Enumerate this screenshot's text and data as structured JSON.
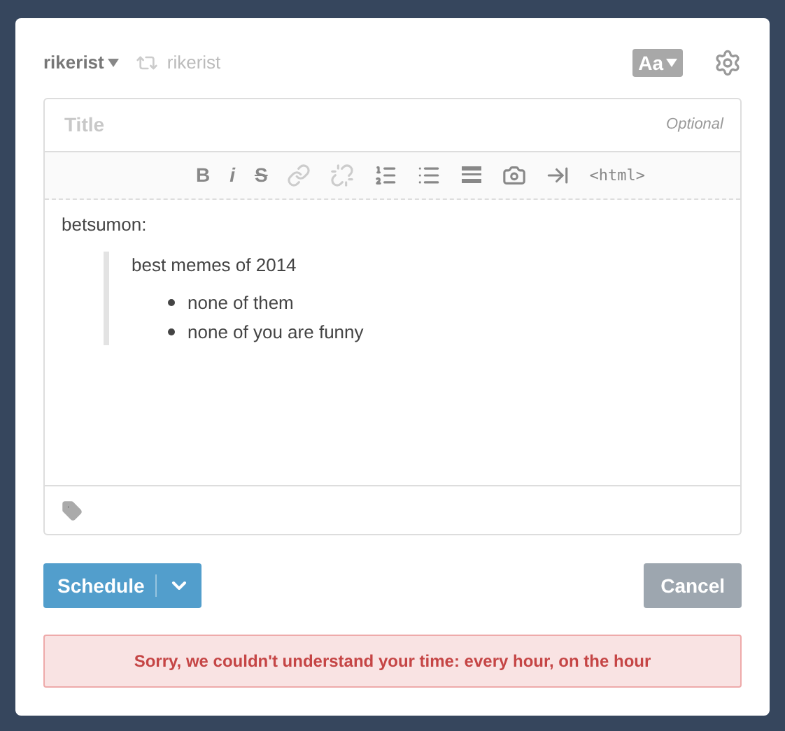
{
  "header": {
    "blog": "rikerist",
    "reblog_from": "rikerist",
    "text_style": "Aa"
  },
  "title_field": {
    "placeholder": "Title",
    "hint": "Optional"
  },
  "toolbar": [
    {
      "kind": "text",
      "label": "B",
      "disabled": false
    },
    {
      "kind": "text",
      "label": "i",
      "disabled": false
    },
    {
      "kind": "text",
      "label": "S",
      "disabled": false
    },
    {
      "kind": "link",
      "disabled": true
    },
    {
      "kind": "unlink",
      "disabled": true
    },
    {
      "kind": "ordered-list",
      "disabled": false
    },
    {
      "kind": "bullet-list",
      "disabled": false
    },
    {
      "kind": "rule",
      "disabled": false
    },
    {
      "kind": "camera",
      "disabled": false
    },
    {
      "kind": "read-more",
      "disabled": false
    },
    {
      "kind": "text",
      "label": "<html>",
      "disabled": false
    }
  ],
  "body": {
    "attribution": "betsumon:",
    "quote": "best memes of 2014",
    "list": [
      "none of them",
      "none of you are funny"
    ]
  },
  "buttons": {
    "primary": "Schedule",
    "cancel": "Cancel"
  },
  "error": "Sorry, we couldn't understand your time: every hour, on the hour"
}
